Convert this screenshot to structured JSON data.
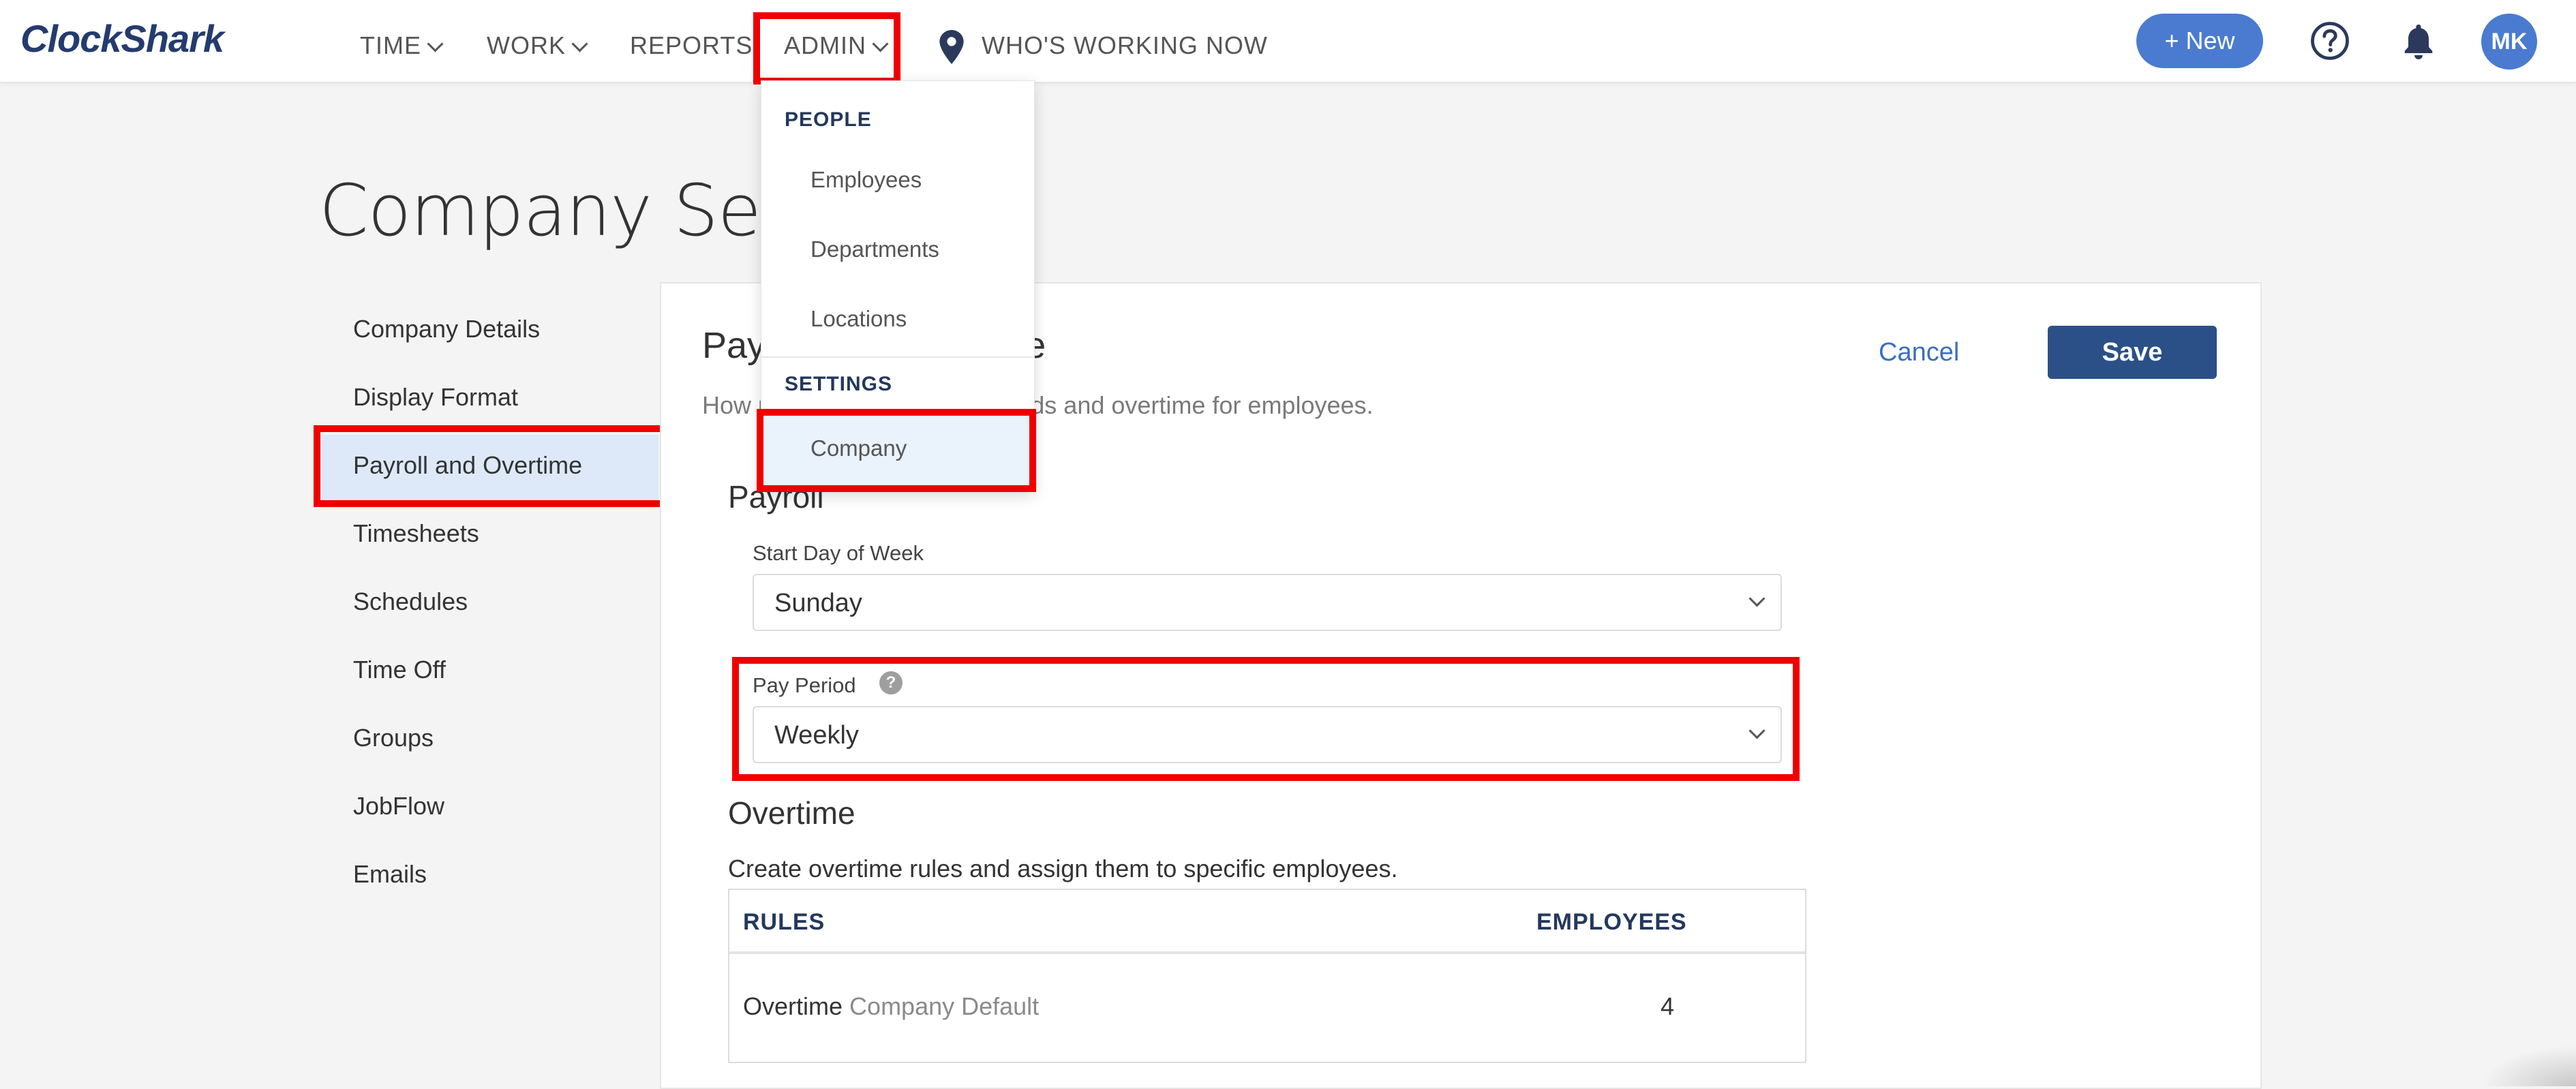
{
  "app": {
    "logo_text": "ClockShark"
  },
  "nav": {
    "items": [
      {
        "label": "TIME"
      },
      {
        "label": "WORK"
      },
      {
        "label": "REPORTS"
      },
      {
        "label": "ADMIN"
      },
      {
        "label": "WHO'S WORKING NOW"
      }
    ],
    "new_button": "+ New",
    "avatar_initials": "MK"
  },
  "page": {
    "title": "Company Settings"
  },
  "sidebar": {
    "items": [
      {
        "label": "Company Details"
      },
      {
        "label": "Display Format"
      },
      {
        "label": "Payroll and Overtime"
      },
      {
        "label": "Timesheets"
      },
      {
        "label": "Schedules"
      },
      {
        "label": "Time Off"
      },
      {
        "label": "Groups"
      },
      {
        "label": "JobFlow"
      },
      {
        "label": "Emails"
      }
    ],
    "active_index": 2
  },
  "main": {
    "heading": "Payroll and Overtime",
    "description": "How payroll handles pay periods and overtime for employees.",
    "cancel_label": "Cancel",
    "save_label": "Save",
    "payroll": {
      "title": "Payroll",
      "start_day_label": "Start Day of Week",
      "start_day_value": "Sunday",
      "pay_period_label": "Pay Period",
      "pay_period_value": "Weekly",
      "help_glyph": "?"
    },
    "overtime": {
      "title": "Overtime",
      "description": "Create overtime rules and assign them to specific employees.",
      "columns": [
        "RULES",
        "EMPLOYEES"
      ],
      "rows": [
        {
          "rule": "Overtime",
          "tag": "Company Default",
          "employees": "4"
        }
      ]
    }
  },
  "admin_menu": {
    "sections": [
      {
        "header": "PEOPLE",
        "items": [
          "Employees",
          "Departments",
          "Locations"
        ]
      },
      {
        "header": "SETTINGS",
        "items": [
          "Company"
        ]
      }
    ]
  },
  "icons": {
    "help": "question-circle-icon",
    "notifications": "bell-icon",
    "location": "map-pin-icon"
  },
  "colors": {
    "brand": "#243b6e",
    "accent": "#4a7bd0",
    "save": "#2b5088",
    "highlight": "#ef0000"
  }
}
